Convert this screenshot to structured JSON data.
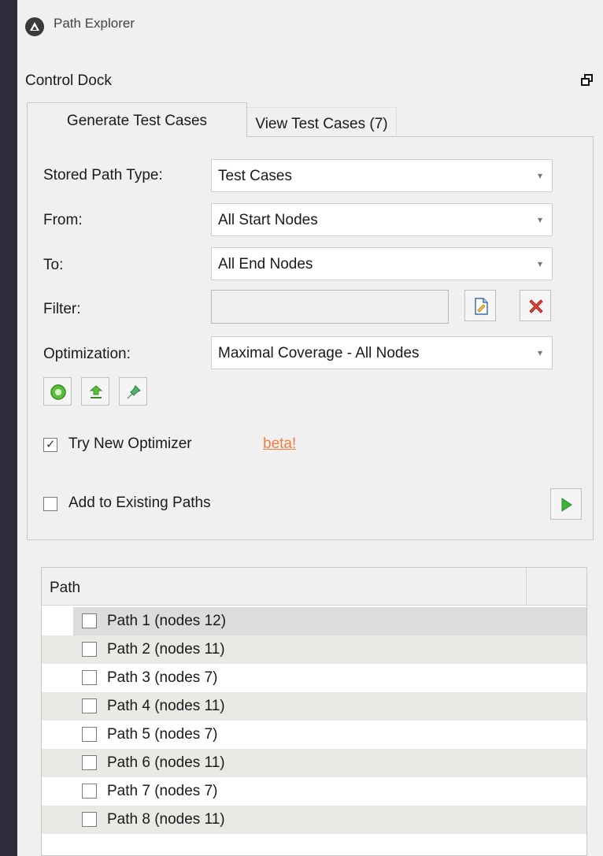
{
  "app": {
    "title": "Path Explorer"
  },
  "dock": {
    "title": "Control Dock"
  },
  "tabs": [
    {
      "label": "Generate Test Cases",
      "active": true
    },
    {
      "label": "View Test Cases (7)",
      "active": false
    }
  ],
  "form": {
    "stored_path_type": {
      "label": "Stored Path Type:",
      "value": "Test Cases"
    },
    "from": {
      "label": "From:",
      "value": "All Start Nodes"
    },
    "to": {
      "label": "To:",
      "value": "All End Nodes"
    },
    "filter": {
      "label": "Filter:",
      "value": ""
    },
    "optimization": {
      "label": "Optimization:",
      "value": "Maximal Coverage - All Nodes"
    }
  },
  "options": {
    "try_new_optimizer": {
      "label": "Try New Optimizer",
      "checked": true,
      "checkmark": "✓"
    },
    "beta_link": "beta!",
    "add_to_existing": {
      "label": "Add to Existing Paths",
      "checked": false
    }
  },
  "table": {
    "column_header": "Path",
    "rows": [
      {
        "label": "Path 1 (nodes 12)"
      },
      {
        "label": "Path 2 (nodes 11)"
      },
      {
        "label": "Path 3 (nodes 7)"
      },
      {
        "label": "Path 4 (nodes 11)"
      },
      {
        "label": "Path 5 (nodes 7)"
      },
      {
        "label": "Path 6 (nodes 11)"
      },
      {
        "label": "Path 7 (nodes 7)"
      },
      {
        "label": "Path 8 (nodes 11)"
      }
    ]
  },
  "icons": {
    "app_logo": "app-logo-icon",
    "float": "float-window-icon",
    "edit_filter": "edit-filter-icon",
    "clear_filter": "clear-filter-icon",
    "generate": "gear-icon",
    "refresh": "refresh-icon",
    "pin": "pin-icon",
    "run": "play-icon"
  },
  "colors": {
    "accent_link": "#f27d3d",
    "window_bg": "#f0f0f0",
    "outer_bg": "#2e2d3c",
    "row_shade": "#e9e9e5",
    "play_green": "#3cb43c",
    "clear_red": "#e0433a"
  }
}
